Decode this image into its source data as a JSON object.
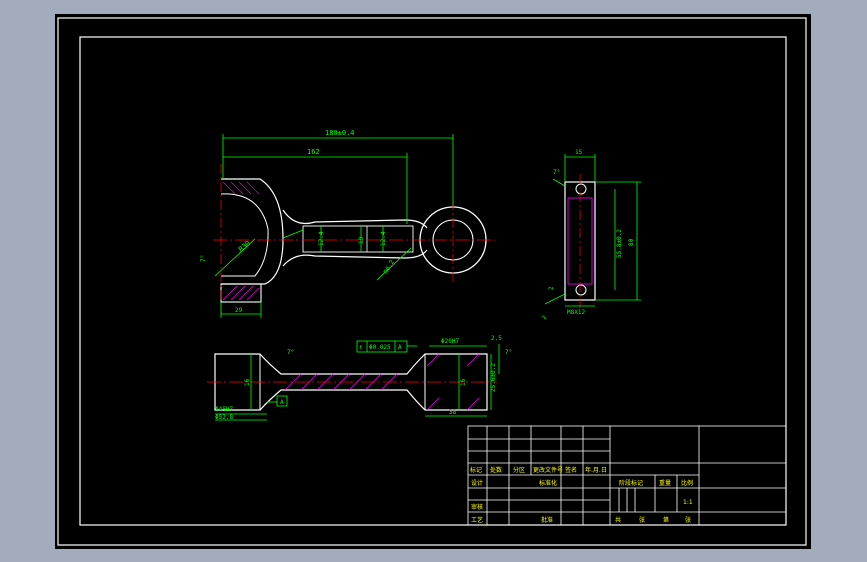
{
  "colors": {
    "background": "#a3acbc",
    "canvas": "#000000",
    "frame": "#ffffff",
    "part_outline": "#ffffff",
    "dimension": "#00ff00",
    "centerline": "#ff0000",
    "hatch": "#ff00ff",
    "text_yellow": "#ffff00"
  },
  "front_view": {
    "dims": {
      "overall_length": "180±0.4",
      "center_length": "162",
      "bore_dia": "R30",
      "shank_h1": "12.4",
      "shank_w": "19",
      "shank_h2": "12.4",
      "fillet": "R6.2",
      "angle": "7°",
      "rib": "29"
    }
  },
  "side_view": {
    "dims": {
      "width_top": "15",
      "angle": "7°",
      "inner_h": "55.8±0.2",
      "outer_h": "80",
      "bolt_hole": "M8X12",
      "small_1": "2",
      "small_2": "2"
    }
  },
  "section_view": {
    "dims": {
      "tolerance_box_1": "r",
      "tolerance_box_2": "Φ0.025",
      "tolerance_box_3": "A",
      "top_hole": "Φ20H7",
      "top_right": "2.5",
      "angle_left": "7°",
      "angle_right": "7°",
      "left_h": "16",
      "right_h": "16",
      "right_dia": "25.6±0.2",
      "left_dia1": "Φ45H7",
      "datum": "A",
      "left_dia2": "Φ52.8",
      "bottom_w": "38"
    }
  },
  "title_block": {
    "header_labels": [
      "标记",
      "处数",
      "分区",
      "更改文件号",
      "签名",
      "年.月.日"
    ],
    "row_labels": [
      "设计",
      "审核",
      "工艺"
    ],
    "standardized": "标准化",
    "approved": "批准",
    "stage_mark": "阶段标记",
    "weight": "重量",
    "scale_label": "比例",
    "scale_value": "1:1",
    "sheets_total": "共",
    "sheets_unit1": "张",
    "sheet_no": "第",
    "sheets_unit2": "张"
  }
}
